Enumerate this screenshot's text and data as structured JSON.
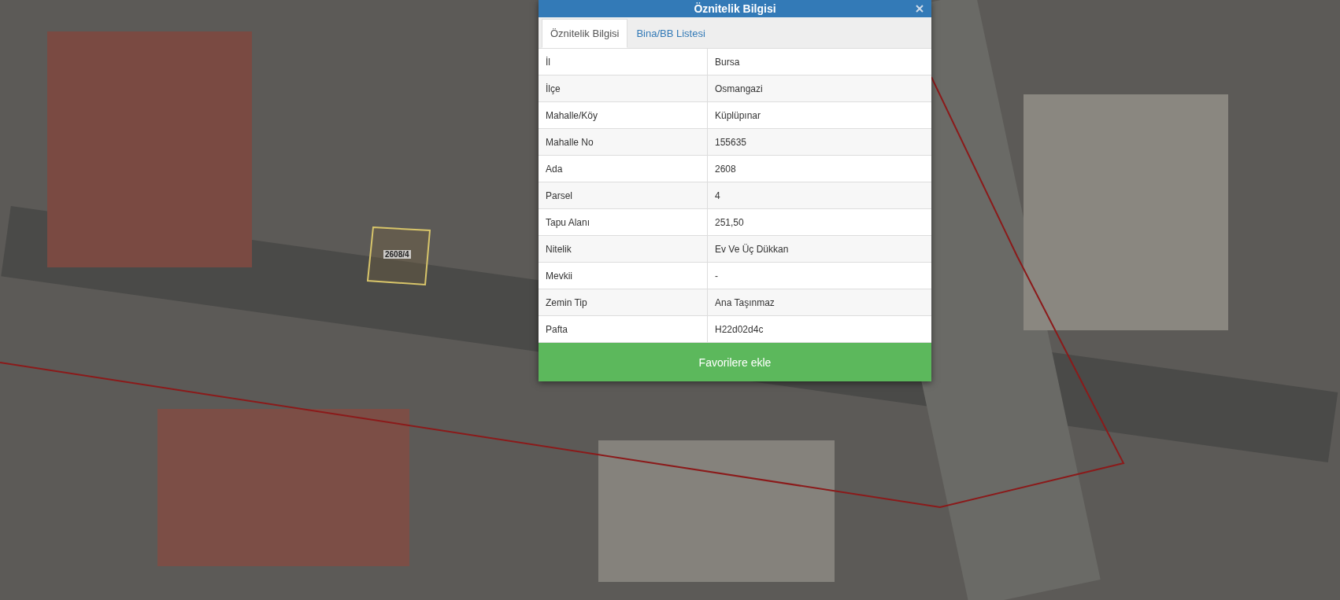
{
  "map": {
    "parcel_label": "2608/4"
  },
  "panel": {
    "title": "Öznitelik Bilgisi",
    "tabs": [
      {
        "label": "Öznitelik Bilgisi",
        "selected": true
      },
      {
        "label": "Bina/BB Listesi",
        "selected": false
      }
    ],
    "rows": [
      {
        "label": "İl",
        "value": "Bursa"
      },
      {
        "label": "İlçe",
        "value": "Osmangazi"
      },
      {
        "label": "Mahalle/Köy",
        "value": "Küplüpınar"
      },
      {
        "label": "Mahalle No",
        "value": "155635"
      },
      {
        "label": "Ada",
        "value": "2608"
      },
      {
        "label": "Parsel",
        "value": "4"
      },
      {
        "label": "Tapu Alanı",
        "value": "251,50"
      },
      {
        "label": "Nitelik",
        "value": "Ev Ve Üç Dükkan"
      },
      {
        "label": "Mevkii",
        "value": "-"
      },
      {
        "label": "Zemin Tip",
        "value": "Ana Taşınmaz"
      },
      {
        "label": "Pafta",
        "value": "H22d02d4c"
      }
    ],
    "button": "Favorilere ekle"
  }
}
